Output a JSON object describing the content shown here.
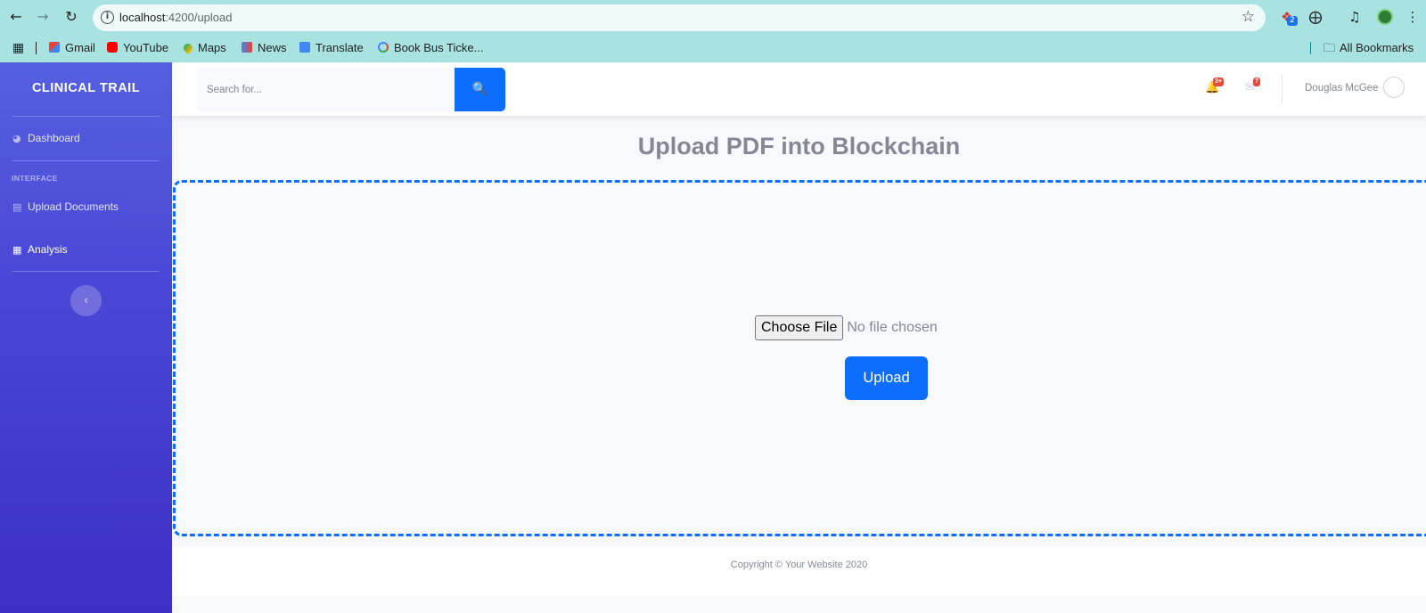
{
  "browser": {
    "url_host": "localhost",
    "url_path": ":4200/upload",
    "extension_badge": "2",
    "bookmarks": [
      {
        "label": "Gmail",
        "icon": "gmail-icon"
      },
      {
        "label": "YouTube",
        "icon": "youtube-icon"
      },
      {
        "label": "Maps",
        "icon": "maps-icon"
      },
      {
        "label": "News",
        "icon": "news-icon"
      },
      {
        "label": "Translate",
        "icon": "translate-icon"
      },
      {
        "label": "Book Bus Ticke...",
        "icon": "google-icon"
      }
    ],
    "all_bookmarks": "All Bookmarks"
  },
  "sidebar": {
    "brand": "CLINICAL TRAIL",
    "heading": "INTERFACE",
    "items": [
      {
        "label": "Dashboard",
        "icon": "tachometer-icon"
      },
      {
        "label": "Upload Documents",
        "icon": "chart-area-icon"
      },
      {
        "label": "Analysis",
        "icon": "table-icon"
      }
    ],
    "toggle_icon": "chevron-left-icon"
  },
  "topbar": {
    "search_placeholder": "Search for...",
    "alerts_badge": "3+",
    "messages_badge": "7",
    "user_name": "Douglas McGee"
  },
  "main": {
    "title": "Upload PDF into Blockchain",
    "choose_file_label": "Choose File",
    "file_status": "No file chosen",
    "upload_label": "Upload"
  },
  "footer": {
    "copyright": "Copyright © Your Website 2020"
  },
  "colors": {
    "primary": "#0d6efd",
    "sidebar_top": "#5560e0",
    "sidebar_bottom": "#3b2fc5",
    "text_muted": "#858796",
    "browser_chrome": "#a8e3e1"
  }
}
